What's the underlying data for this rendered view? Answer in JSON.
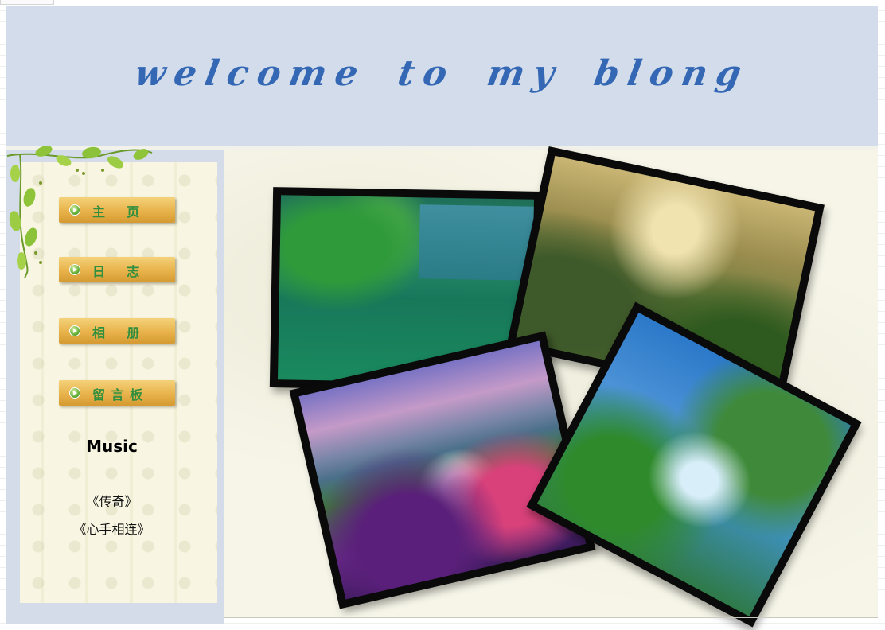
{
  "header": {
    "title": "welcome to my blong"
  },
  "nav": {
    "items": [
      {
        "label": "主    页"
      },
      {
        "label": "日    志"
      },
      {
        "label": "相    册"
      },
      {
        "label": "留 言 板"
      }
    ]
  },
  "music": {
    "heading": "Music",
    "songs": [
      "《传奇》",
      "《心手相连》"
    ]
  },
  "gallery": {
    "photos": [
      {
        "icon": "lake-photo"
      },
      {
        "icon": "mountain-painting-photo"
      },
      {
        "icon": "flower-field-photo"
      },
      {
        "icon": "waterfall-photo"
      }
    ]
  },
  "colors": {
    "header_bg": "#d3dcea",
    "title": "#3468b4",
    "nav_button": "#e8b24a",
    "nav_text": "#2f8f3f",
    "content_bg": "#f6f5e8"
  }
}
